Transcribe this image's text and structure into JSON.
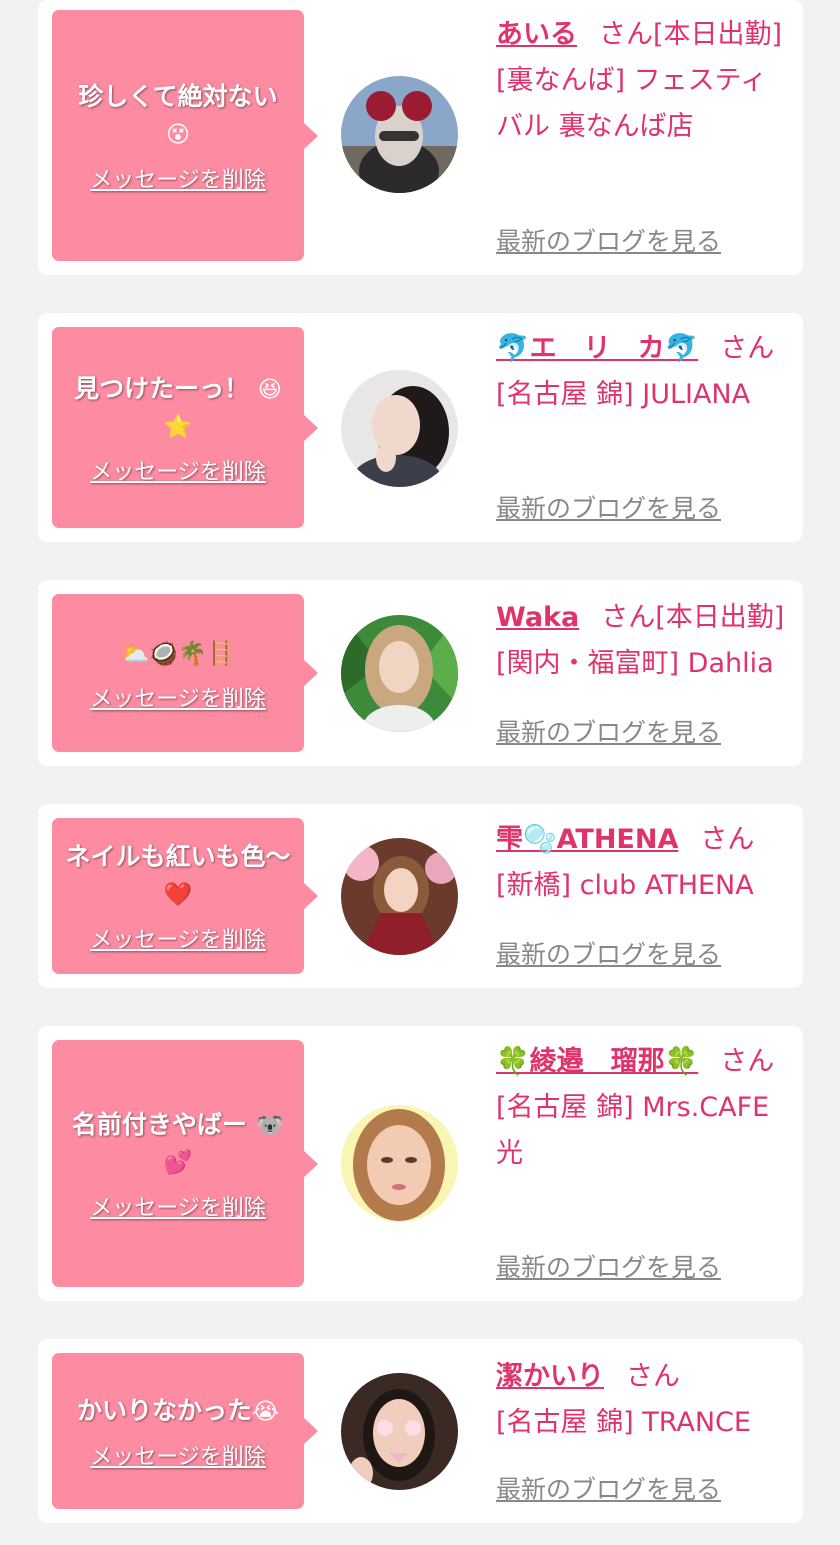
{
  "posts": [
    {
      "message": "珍しくて絶対ない",
      "emoji": "😵",
      "delete_label": "メッセージを削除",
      "name": "あいる",
      "honorific": "さん",
      "status": "[本日出勤]",
      "store": "[裏なんば] フェスティバル 裏なんば店",
      "blog_label": "最新のブログを見る"
    },
    {
      "message": "見つけたーっ！",
      "emoji": "😆⭐",
      "delete_label": "メッセージを削除",
      "name": "🐬エ　リ　カ🐬",
      "honorific": "さん",
      "status": "",
      "store": "[名古屋 錦] JULIANA",
      "blog_label": "最新のブログを見る"
    },
    {
      "message": "",
      "emoji": "⛅🥥🌴🪜",
      "delete_label": "メッセージを削除",
      "name": "Waka",
      "honorific": "さん",
      "status": "[本日出勤]",
      "store": "[関内・福富町] Dahlia",
      "blog_label": "最新のブログを見る"
    },
    {
      "message": "ネイルも紅いも色〜",
      "emoji": "❤️",
      "delete_label": "メッセージを削除",
      "name": "雫🫧ATHENA",
      "honorific": "さん",
      "status": "",
      "store": "[新橋] club ATHENA",
      "blog_label": "最新のブログを見る"
    },
    {
      "message": "名前付きやばー",
      "emoji": "🐨💕",
      "delete_label": "メッセージを削除",
      "name": "🍀綾邉　瑠那🍀",
      "honorific": "さん",
      "status": "",
      "store": "[名古屋 錦] Mrs.CAFE 光",
      "blog_label": "最新のブログを見る"
    },
    {
      "message": "かいりなかった",
      "emoji": "😭",
      "delete_label": "メッセージを削除",
      "name": "潔かいり",
      "honorific": "さん",
      "status": "",
      "store": "[名古屋 錦] TRANCE",
      "blog_label": "最新のブログを見る"
    }
  ],
  "colors": {
    "background": "#f2f2f2",
    "card": "#ffffff",
    "bubble": "#fd8ba1",
    "accent": "#e0336b",
    "link_gray": "#888888"
  }
}
